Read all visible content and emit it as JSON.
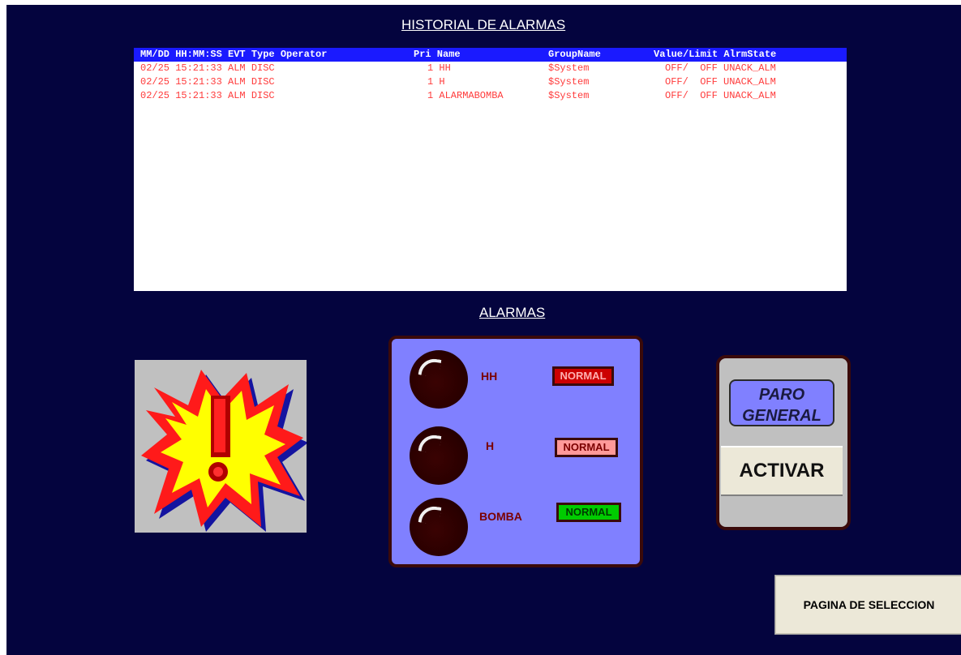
{
  "history": {
    "title": "HISTORIAL DE ALARMAS",
    "header": {
      "date_time_evt": "MM/DD HH:MM:SS EVT Type Operator",
      "pri_name": "Pri Name",
      "group": "GroupName",
      "value_state": "Value/Limit AlrmState"
    },
    "rows": [
      {
        "date_time_evt": "02/25 15:21:33 ALM DISC",
        "pri_name": "1 HH",
        "group": "$System",
        "value_state": "OFF/  OFF UNACK_ALM"
      },
      {
        "date_time_evt": "02/25 15:21:33 ALM DISC",
        "pri_name": "1 H",
        "group": "$System",
        "value_state": "OFF/  OFF UNACK_ALM"
      },
      {
        "date_time_evt": "02/25 15:21:33 ALM DISC",
        "pri_name": "1 ALARMABOMBA",
        "group": "$System",
        "value_state": "OFF/  OFF UNACK_ALM"
      }
    ]
  },
  "alarms": {
    "title": "ALARMAS",
    "items": [
      {
        "label": "HH",
        "status": "NORMAL",
        "status_bg": "#cc0000",
        "status_fg": "#ffb0b0"
      },
      {
        "label": "H",
        "status": "NORMAL",
        "status_bg": "#ff9999",
        "status_fg": "#7a0000"
      },
      {
        "label": "BOMBA",
        "status": "NORMAL",
        "status_bg": "#00cc00",
        "status_fg": "#003a00"
      }
    ]
  },
  "paro": {
    "label_line1": "PARO",
    "label_line2": "GENERAL",
    "button": "ACTIVAR"
  },
  "navigation": {
    "selection_button": "PAGINA DE SELECCION"
  },
  "colors": {
    "background": "#04043e",
    "header_bar": "#1a1aff",
    "alarm_text": "#ff3b3b",
    "panel": "#8080ff"
  },
  "icons": [
    "warning-explosion-icon",
    "alarm-lamp-icon"
  ]
}
